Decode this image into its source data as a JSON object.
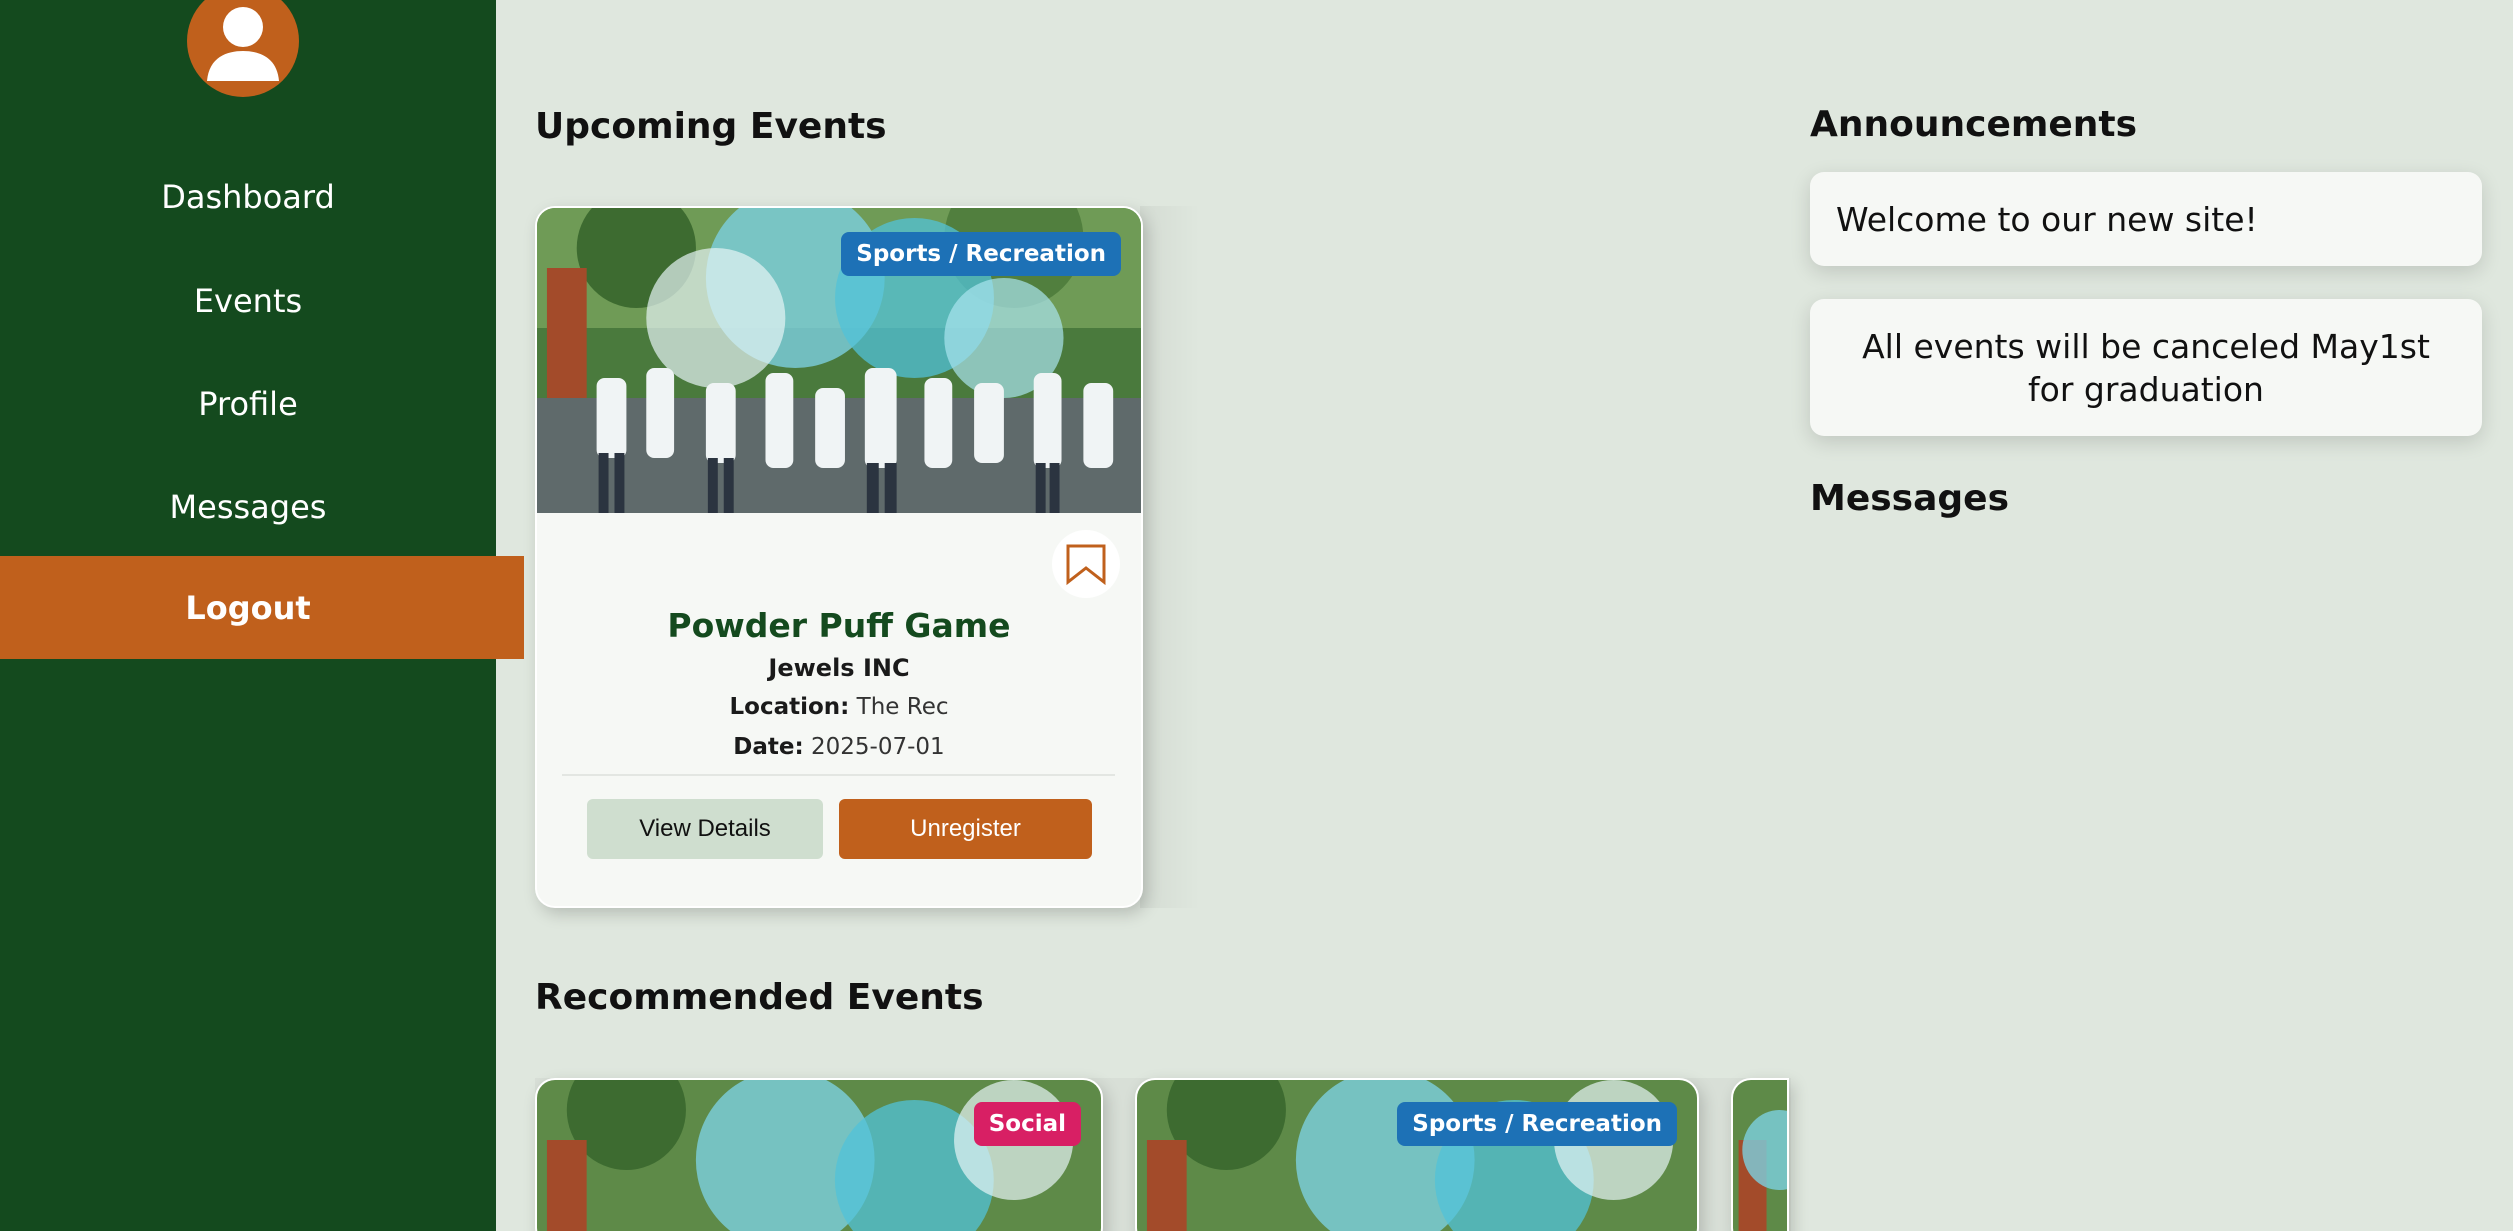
{
  "sidebar": {
    "nav": {
      "dashboard": "Dashboard",
      "events": "Events",
      "profile": "Profile",
      "messages": "Messages",
      "logout": "Logout"
    }
  },
  "upcoming": {
    "title": "Upcoming Events",
    "events": [
      {
        "category": "Sports / Recreation",
        "name": "Powder Puff Game",
        "organizer": "Jewels INC",
        "location_label": "Location:",
        "location": "The Rec",
        "date_label": "Date:",
        "date": "2025-07-01",
        "view_label": "View Details",
        "action_label": "Unregister"
      }
    ]
  },
  "recommended": {
    "title": "Recommended Events",
    "events": [
      {
        "category": "Social"
      },
      {
        "category": "Sports / Recreation"
      }
    ]
  },
  "announcements": {
    "title": "Announcements",
    "items": [
      "Welcome to our new site!",
      "All events will be canceled May1st for graduation"
    ]
  },
  "messages": {
    "title": "Messages"
  },
  "colors": {
    "sidebar": "#144a1e",
    "accent": "#c0601c",
    "background": "#dfe7de",
    "badge_sports": "#1d71b6",
    "badge_social": "#d81f64"
  },
  "icons": [
    "user-avatar-icon",
    "bookmark-icon"
  ]
}
